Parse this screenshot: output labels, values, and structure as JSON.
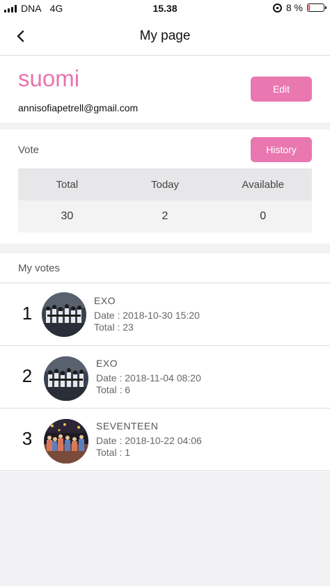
{
  "status_bar": {
    "carrier": "DNA",
    "network": "4G",
    "time": "15.38",
    "battery": "8 %",
    "battery_level": 0.08
  },
  "nav": {
    "title": "My page",
    "back_icon": "chevron-left-icon"
  },
  "profile": {
    "name": "suomi",
    "email": "annisofiapetrell@gmail.com",
    "edit_label": "Edit"
  },
  "vote": {
    "label": "Vote",
    "history_label": "History",
    "headers": [
      "Total",
      "Today",
      "Available"
    ],
    "values": [
      "30",
      "2",
      "0"
    ]
  },
  "my_votes": {
    "label": "My votes",
    "items": [
      {
        "rank": "1",
        "name": "EXO",
        "date": "Date : 2018-10-30 15:20",
        "total": "Total : 23"
      },
      {
        "rank": "2",
        "name": "EXO",
        "date": "Date : 2018-11-04 08:20",
        "total": "Total : 6"
      },
      {
        "rank": "3",
        "name": "SEVENTEEN",
        "date": "Date : 2018-10-22 04:06",
        "total": "Total : 1"
      }
    ]
  },
  "colors": {
    "accent": "#e978b1",
    "name": "#e973ad"
  }
}
